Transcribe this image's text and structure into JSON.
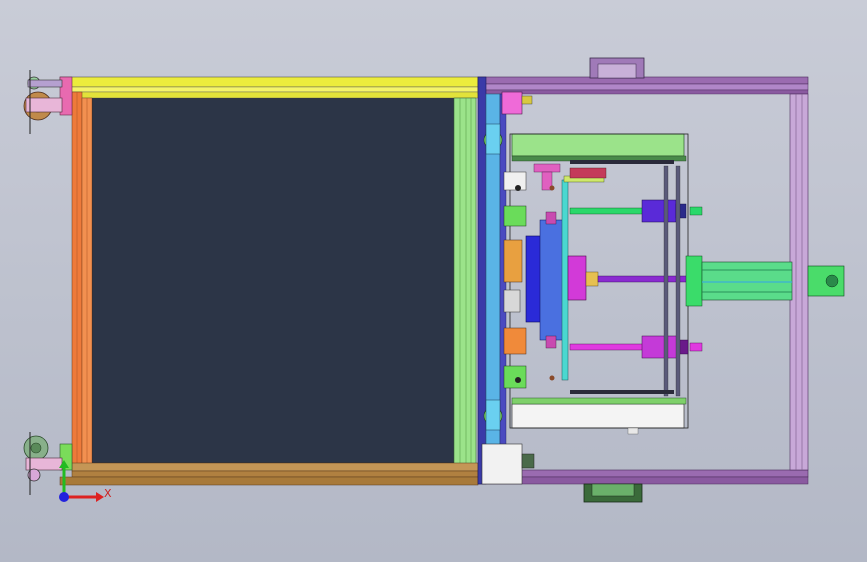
{
  "viewport": {
    "background_top": "#c9ccd7",
    "background_bottom": "#b3b8c6"
  },
  "model": {
    "colors": {
      "left_frame_top": "#e8e83a",
      "left_frame_left": "#ee7a3a",
      "left_frame_right": "#9be38a",
      "left_frame_bottom": "#b88a4a",
      "panel": "#2c3547",
      "right_frame": "#9a6bb0",
      "right_frame_dark": "#6e4a86",
      "blue_rail": "#3a3aa8",
      "light_blue": "#5ab4e6",
      "green_block": "#7fd87a",
      "magenta": "#d23ad8",
      "cyan": "#4ad8d0",
      "purple_rod": "#8a2ad0"
    },
    "icons": [
      "caster-wheel-icon",
      "handle-icon",
      "coordinate-triad-icon"
    ]
  },
  "triad": {
    "x_axis_label": "X",
    "x_color": "#dd2222",
    "y_color": "#22bb22",
    "z_color": "#2222dd"
  }
}
